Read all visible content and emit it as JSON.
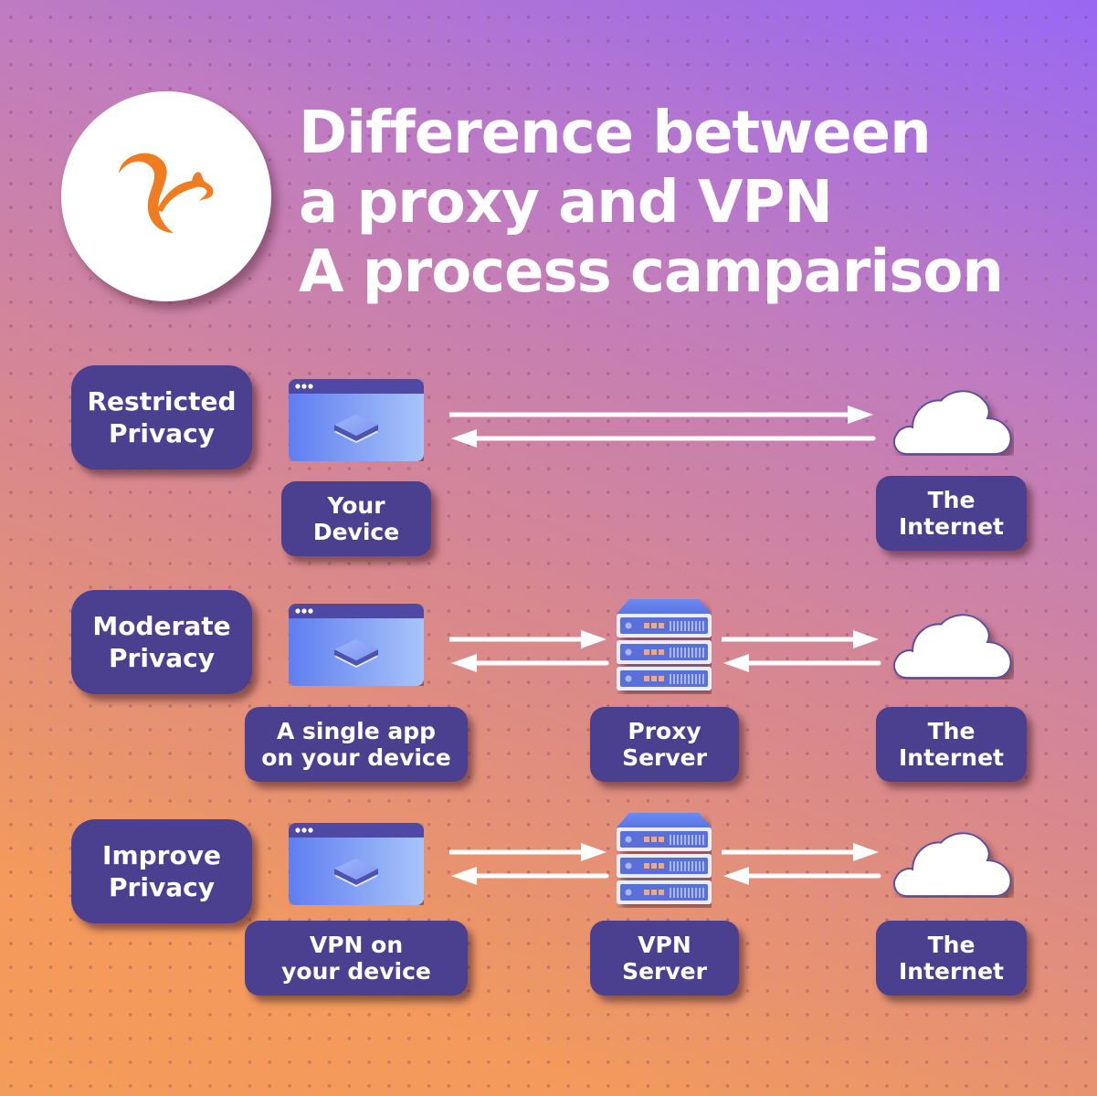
{
  "header": {
    "title_lines": [
      "Difference between",
      "a proxy and VPN",
      "A process camparison"
    ],
    "logo": "squirrel-logo"
  },
  "colors": {
    "box_fill": "#4b3f90",
    "logo_orange": "#f07c22",
    "gradient_top_right": "#9a6af0",
    "gradient_bottom_left": "#f49c5a",
    "device_blue": "#6a8cf0",
    "device_bar": "#4f4aa6"
  },
  "rows": [
    {
      "privacy_level": [
        "Restricted",
        "Privacy"
      ],
      "nodes": [
        {
          "icon": "browser-window-icon",
          "label": [
            "Your",
            "Device"
          ]
        },
        {
          "icon": "cloud-icon",
          "label": [
            "The",
            "Internet"
          ]
        }
      ]
    },
    {
      "privacy_level": [
        "Moderate",
        "Privacy"
      ],
      "nodes": [
        {
          "icon": "browser-window-icon",
          "label": [
            "A single app",
            "on your device"
          ]
        },
        {
          "icon": "server-icon",
          "label": [
            "Proxy",
            "Server"
          ]
        },
        {
          "icon": "cloud-icon",
          "label": [
            "The",
            "Internet"
          ]
        }
      ]
    },
    {
      "privacy_level": [
        "Improve",
        "Privacy"
      ],
      "nodes": [
        {
          "icon": "browser-window-icon",
          "label": [
            "VPN on",
            "your device"
          ]
        },
        {
          "icon": "server-icon",
          "label": [
            "VPN",
            "Server"
          ]
        },
        {
          "icon": "cloud-icon",
          "label": [
            "The",
            "Internet"
          ]
        }
      ]
    }
  ]
}
